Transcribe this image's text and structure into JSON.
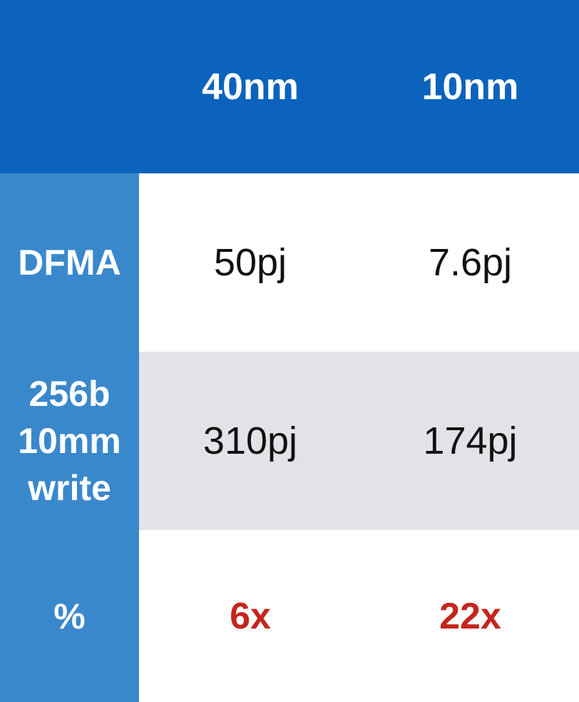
{
  "header": {
    "corner_label": "",
    "columns": [
      "40nm",
      "10nm"
    ]
  },
  "rows": [
    {
      "label_lines": [
        "DFMA"
      ],
      "values": [
        "50pj",
        "7.6pj"
      ]
    },
    {
      "label_lines": [
        "256b",
        "10mm",
        "write"
      ],
      "values": [
        "310pj",
        "174pj"
      ]
    },
    {
      "label_lines": [
        "%"
      ],
      "values": [
        "6x",
        "22x"
      ]
    }
  ],
  "colors": {
    "header_bg": "#0b63bd",
    "row_header_bg": "#3a88cc",
    "alt_row_bg": "#e2e3e7",
    "ratio_text": "#c4261c"
  }
}
